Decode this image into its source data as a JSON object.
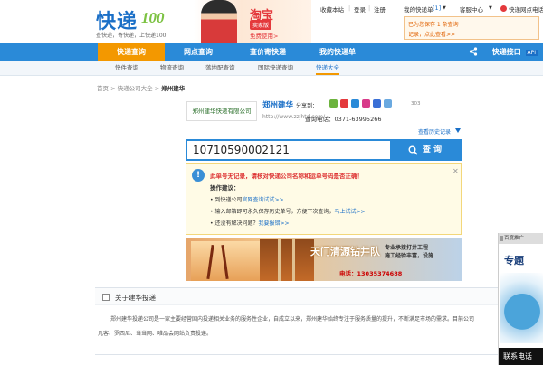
{
  "header": {
    "logo_main": "快递",
    "logo_num": "100",
    "logo_sub": "查快递，寄快递，上快递100",
    "ad": {
      "brand": "淘宝",
      "tag": "卖家版",
      "cta": "免费使用>"
    },
    "links": {
      "favorite": "收藏本站",
      "login": "登录",
      "register": "注册",
      "my_check": "我的快递单",
      "my_check_count": "[1]",
      "customer": "客服中心",
      "phone_hint": "快递网点电话"
    },
    "notice": {
      "line1": "已为您保存 1 条查询",
      "line2": "记录，点此查看>>"
    }
  },
  "nav": {
    "items": [
      "快递查询",
      "网点查询",
      "查价寄快递",
      "我的快递单"
    ],
    "right": "快递接口",
    "right_suffix": "API"
  },
  "subnav": {
    "items": [
      "快件查询",
      "物流查询",
      "落地配查询",
      "国际快递查询",
      "快递大全"
    ]
  },
  "breadcrumb": {
    "home": "首页",
    "sep1": ">",
    "company_list": "快递公司大全",
    "sep2": ">",
    "current": "郑州建华"
  },
  "company": {
    "logo_text": "郑州建华快递有限公司",
    "name": "郑州建华",
    "share_label": "分享到：",
    "share_count": "303",
    "url": "http://www.zzjhtd.com/",
    "phone": "查询电话：0371-63995266",
    "history": "查看历史记录"
  },
  "search": {
    "value": "10710590002121",
    "button": "查 询"
  },
  "result": {
    "error": "此单号无记录，请核对快递公司名称和运单号码是否正确！",
    "header": "操作建议：",
    "line1": "• 到快递公司",
    "line1_link": "官网查询试试>>",
    "line2": "• 输入邮箱即可永久保存历史单号，方便下次查询，",
    "line2_link": "马上试试>>",
    "line3": "• 还没有解决问题？",
    "line3_link": "我要报错>>",
    "close": "✕"
  },
  "banner": {
    "title": "天门清源钻井队",
    "r1": "专业承接打井工程",
    "r2": "施工经验丰富，设施",
    "tel": "电话：13035374688"
  },
  "about": {
    "title": "关于建华投递",
    "p1": "郑州建华投递公司是一家主要经营国内投递相关业务的服务性企业，自成立以来，郑州建华始终专注于服务质量的提升，不断满足市场的需求。目前公司",
    "p2": "凡客、罗西尼、当当网、唯品会网站负责投递。"
  },
  "right_ad": {
    "tag": "百度推广",
    "title": "专题",
    "footer": "联系电话"
  },
  "colors": {
    "brand_blue": "#2a8ad8",
    "accent_orange": "#f39800",
    "error_red": "#d33333"
  }
}
